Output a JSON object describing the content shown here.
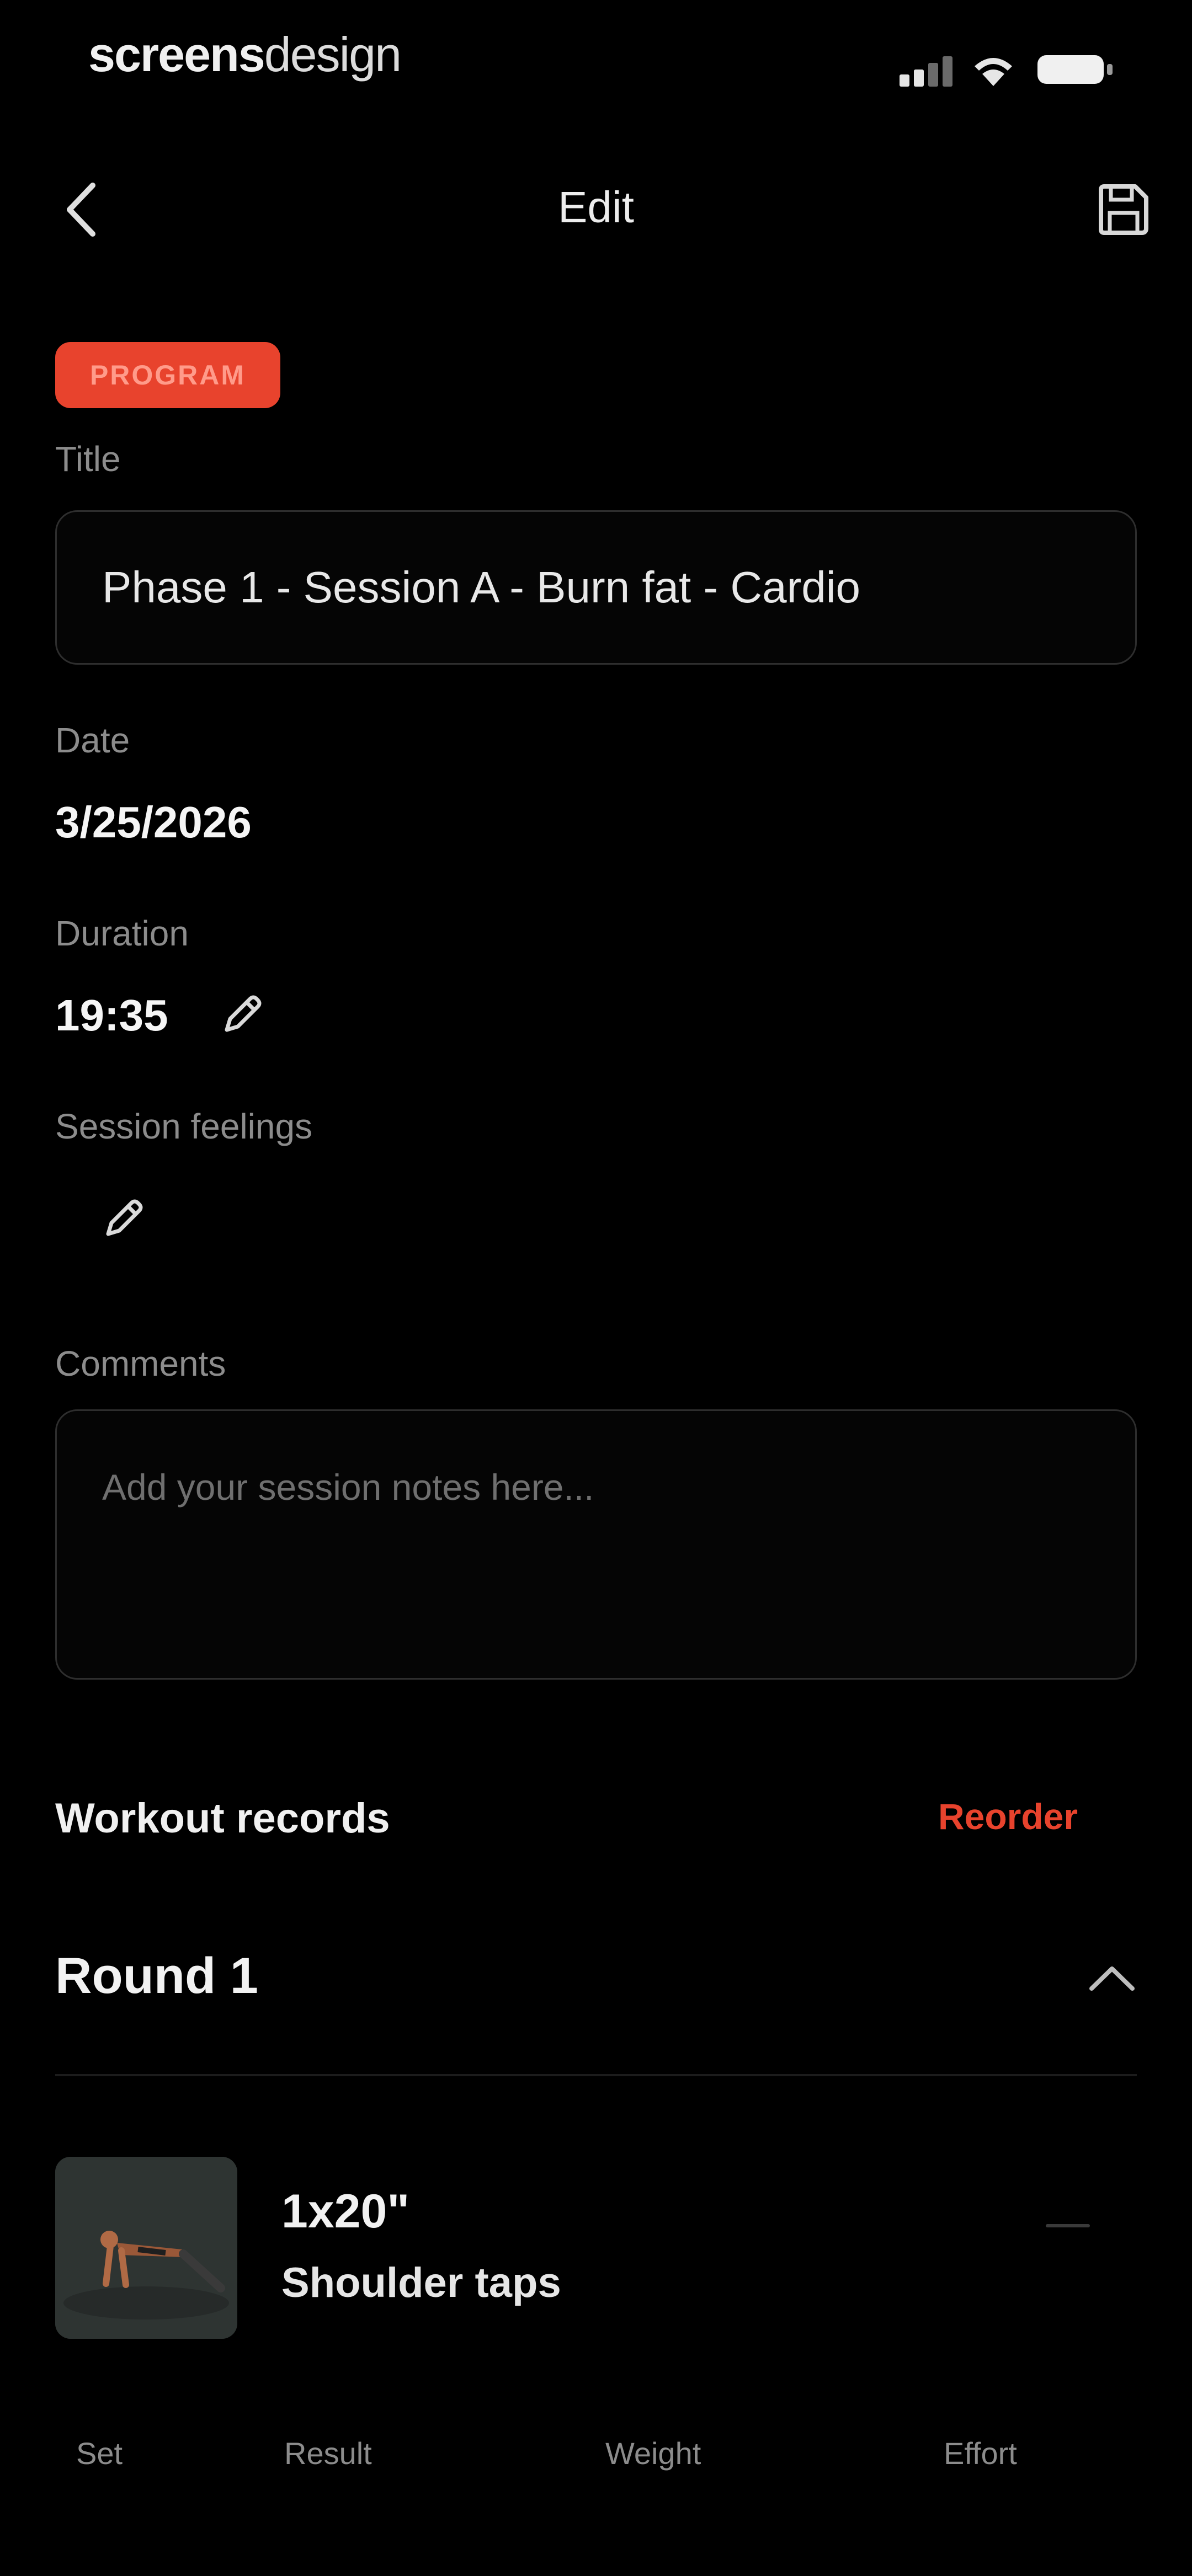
{
  "status_bar": {
    "brand_bold": "screens",
    "brand_light": "design"
  },
  "header": {
    "title": "Edit",
    "back_icon": "chevron-left-icon",
    "save_icon": "floppy-disk-icon"
  },
  "badge": {
    "label": "PROGRAM",
    "color": "#e8432d"
  },
  "form": {
    "title_label": "Title",
    "title_value": "Phase 1 - Session A - Burn fat - Cardio",
    "date_label": "Date",
    "date_value": "3/25/2026",
    "duration_label": "Duration",
    "duration_value": "19:35",
    "feelings_label": "Session feelings",
    "comments_label": "Comments",
    "comments_placeholder": "Add your session notes here..."
  },
  "workout": {
    "section_title": "Workout records",
    "reorder_label": "Reorder",
    "accent": "#e8432d",
    "round_title": "Round 1",
    "exercise": {
      "reps": "1x20\"",
      "name": "Shoulder taps"
    },
    "columns": [
      "Set",
      "Result",
      "Weight",
      "Effort"
    ]
  }
}
